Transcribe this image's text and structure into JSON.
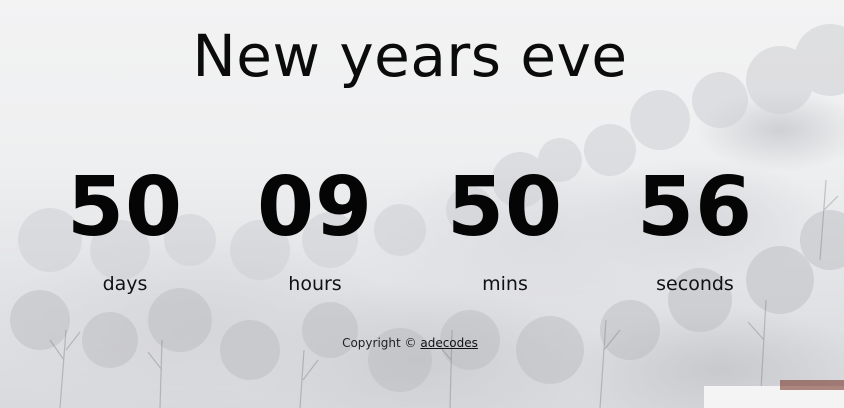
{
  "title": "New years eve",
  "countdown": [
    {
      "value": "50",
      "label": "days"
    },
    {
      "value": "09",
      "label": "hours"
    },
    {
      "value": "50",
      "label": "mins"
    },
    {
      "value": "56",
      "label": "seconds"
    }
  ],
  "footer": {
    "copyright_text": "Copyright ©",
    "link_text": "adecodes"
  }
}
